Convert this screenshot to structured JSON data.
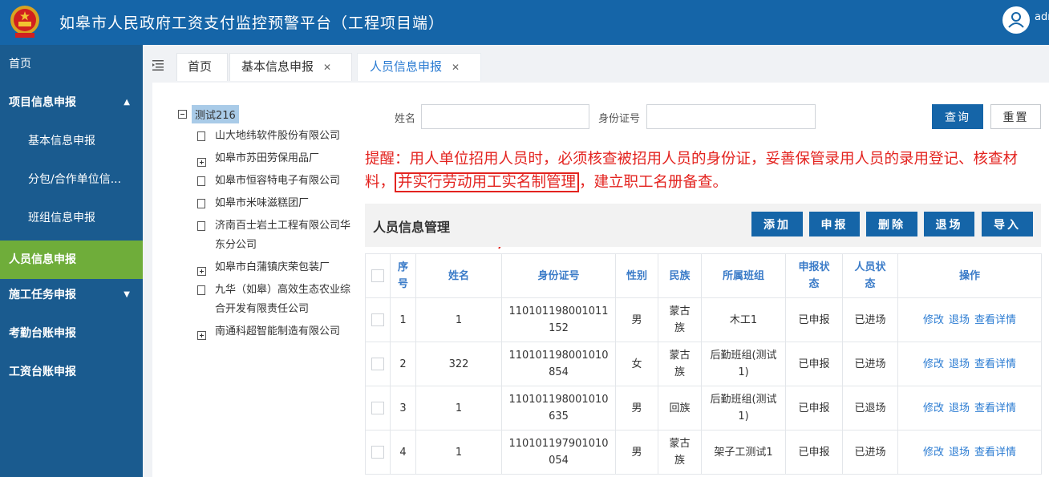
{
  "header": {
    "title": "如皋市人民政府工资支付监控预警平台（工程项目端）",
    "username": "admin"
  },
  "sidebar": {
    "items": [
      {
        "label": "首页"
      },
      {
        "label": "项目信息申报"
      },
      {
        "label": "基本信息申报"
      },
      {
        "label": "分包/合作单位信..."
      },
      {
        "label": "班组信息申报"
      },
      {
        "label": "人员信息申报"
      },
      {
        "label": "施工任务申报"
      },
      {
        "label": "考勤台账申报"
      },
      {
        "label": "工资台账申报"
      }
    ]
  },
  "tabs": [
    {
      "label": "首页"
    },
    {
      "label": "基本信息申报"
    },
    {
      "label": "人员信息申报"
    }
  ],
  "tree": {
    "root": "测试216",
    "nodes": [
      {
        "label": "山大地纬软件股份有限公司",
        "icon": "file-icon"
      },
      {
        "label": "如皋市苏田劳保用品厂",
        "icon": "expand-icon"
      },
      {
        "label": "如皋市恒容特电子有限公司",
        "icon": "file-icon"
      },
      {
        "label": "如皋市米味滋糕团厂",
        "icon": "file-icon"
      },
      {
        "label": "济南百士岩土工程有限公司华",
        "label2": "东分公司",
        "icon": "file-icon"
      },
      {
        "label": "如皋市白蒲镇庆荣包装厂",
        "icon": "expand-icon"
      },
      {
        "label": "九华（如皋）高效生态农业综",
        "label2": "合开发有限责任公司",
        "icon": "file-icon"
      },
      {
        "label": "南通科超智能制造有限公司",
        "icon": "expand-icon"
      }
    ]
  },
  "search": {
    "name_label": "姓名",
    "name_value": "",
    "id_label": "身份证号",
    "id_value": "",
    "query_label": "查询",
    "reset_label": "重置"
  },
  "notice": {
    "prefix": "提醒：用人单位招用人员时，必须核查被招用人员的身份证，妥善保管录用人员的录用登记、核查材料，",
    "highlight": "并实行劳动用工实名制管理",
    "suffix": "，建立职工名册备查。"
  },
  "panel": {
    "title": "人员信息管理",
    "add": "添加",
    "report": "申报",
    "delete": "删除",
    "leave": "退场",
    "import": "导入"
  },
  "table": {
    "headers": [
      "序号",
      "姓名",
      "身份证号",
      "性别",
      "民族",
      "所属班组",
      "申报状态",
      "人员状态",
      "操作"
    ],
    "ops": {
      "edit": "修改",
      "leave": "退场",
      "detail": "查看详情"
    },
    "rows": [
      {
        "seq": "1",
        "name": "1",
        "id": "110101198001011152",
        "gender": "男",
        "ethnic": "蒙古族",
        "team": "木工1",
        "declare": "已申报",
        "status": "已进场"
      },
      {
        "seq": "2",
        "name": "322",
        "id": "110101198001010854",
        "gender": "女",
        "ethnic": "蒙古族",
        "team": "后勤班组(测试1)",
        "declare": "已申报",
        "status": "已进场"
      },
      {
        "seq": "3",
        "name": "1",
        "id": "110101198001010635",
        "gender": "男",
        "ethnic": "回族",
        "team": "后勤班组(测试1)",
        "declare": "已申报",
        "status": "已退场"
      },
      {
        "seq": "4",
        "name": "1",
        "id": "110101197901010054",
        "gender": "男",
        "ethnic": "蒙古族",
        "team": "架子工测试1",
        "declare": "已申报",
        "status": "已进场"
      }
    ]
  },
  "colors": {
    "header_bg": "#1565a8",
    "sidebar_bg": "#1a5b8f",
    "active_green": "#6fad3a",
    "notice_red": "#e3231f"
  }
}
